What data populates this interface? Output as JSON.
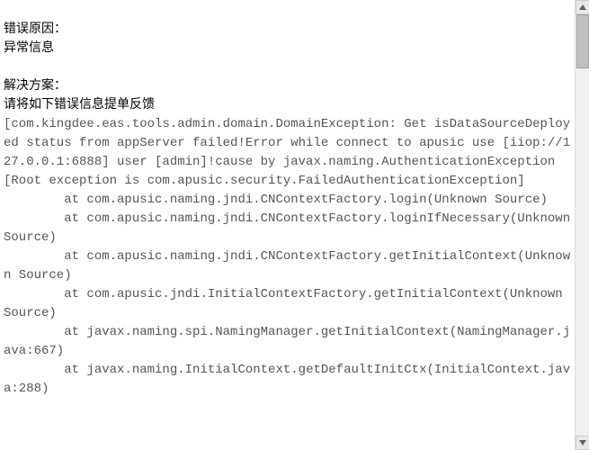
{
  "error": {
    "reason_label": "错误原因：",
    "reason_text": "异常信息",
    "solution_label": "解决方案：",
    "solution_text": "请将如下错误信息提单反馈",
    "stacktrace": "[com.kingdee.eas.tools.admin.domain.DomainException: Get isDataSourceDeployed status from appServer failed!Error while connect to apusic use [iiop://127.0.0.1:6888] user [admin]!cause by javax.naming.AuthenticationException [Root exception is com.apusic.security.FailedAuthenticationException]\n        at com.apusic.naming.jndi.CNContextFactory.login(Unknown Source)\n        at com.apusic.naming.jndi.CNContextFactory.loginIfNecessary(Unknown Source)\n        at com.apusic.naming.jndi.CNContextFactory.getInitialContext(Unknown Source)\n        at com.apusic.jndi.InitialContextFactory.getInitialContext(Unknown Source)\n        at javax.naming.spi.NamingManager.getInitialContext(NamingManager.java:667)\n        at javax.naming.InitialContext.getDefaultInitCtx(InitialContext.java:288)"
  }
}
